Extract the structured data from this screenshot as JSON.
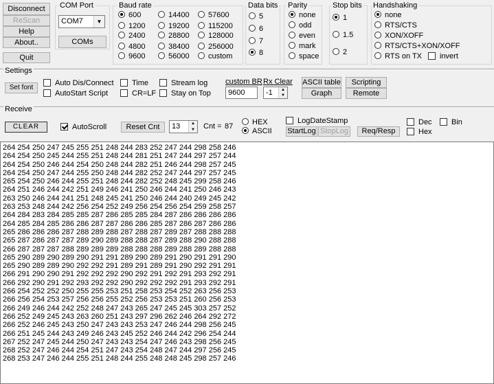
{
  "toolbar": {
    "disconnect": "Disconnect",
    "rescan": "ReScan",
    "help": "Help",
    "about": "About..",
    "quit": "Quit"
  },
  "com_port": {
    "title": "COM Port",
    "selected": "COM7",
    "coms_button": "COMs"
  },
  "baud": {
    "title": "Baud rate",
    "options": [
      "600",
      "1200",
      "2400",
      "4800",
      "9600",
      "14400",
      "19200",
      "28800",
      "38400",
      "56000",
      "57600",
      "115200",
      "128000",
      "256000",
      "custom"
    ],
    "selected": "600"
  },
  "databits": {
    "title": "Data bits",
    "options": [
      "5",
      "6",
      "7",
      "8"
    ],
    "selected": "8"
  },
  "parity": {
    "title": "Parity",
    "options": [
      "none",
      "odd",
      "even",
      "mark",
      "space"
    ],
    "selected": "none"
  },
  "stopbits": {
    "title": "Stop bits",
    "options": [
      "1",
      "1.5",
      "2"
    ],
    "selected": "1"
  },
  "handshaking": {
    "title": "Handshaking",
    "options": [
      "none",
      "RTS/CTS",
      "XON/XOFF",
      "RTS/CTS+XON/XOFF",
      "RTS on TX"
    ],
    "selected": "none",
    "invert_label": "invert"
  },
  "settings": {
    "title": "Settings",
    "set_font": "Set font",
    "auto_dis_connect": "Auto Dis/Connect",
    "autostart_script": "AutoStart Script",
    "time": "Time",
    "cr_lf": "CR=LF",
    "stream_log": "Stream log",
    "stay_on_top": "Stay on Top",
    "custom_br_label": "custom BR",
    "custom_br_value": "9600",
    "rx_clear_label": "Rx Clear",
    "rx_clear_value": "-1",
    "ascii_table": "ASCII table",
    "graph": "Graph",
    "scripting": "Scripting",
    "remote": "Remote"
  },
  "receive": {
    "title": "Receive",
    "clear": "CLEAR",
    "autoscroll": "AutoScroll",
    "reset_cnt": "Reset Cnt",
    "cnt_spin_value": "13",
    "cnt_label": "Cnt =",
    "cnt_value": "87",
    "hex": "HEX",
    "ascii": "ASCII",
    "log_date_stamp": "LogDateStamp",
    "start_log": "StartLog",
    "stop_log": "StopLog",
    "req_resp": "Req/Resp",
    "dec": "Dec",
    "hex_chk": "Hex",
    "bin": "Bin",
    "lines": [
      "264 254 250 247 245 255 251 248 244 283 252 247 244 298 258 246",
      "264 254 250 245 244 255 251 248 244 281 251 247 244 297 257 244",
      "264 254 250 246 244 254 250 248 244 282 251 246 244 298 257 245",
      "264 254 250 247 244 255 250 248 244 282 252 247 244 297 257 245",
      "265 254 250 246 244 255 251 248 244 282 252 248 245 299 258 246",
      "264 251 246 244 242 251 249 246 241 250 246 244 241 250 246 243",
      "263 250 246 244 241 251 248 245 241 250 246 244 240 249 245 242",
      "263 253 248 244 242 256 254 252 249 256 254 256 254 259 258 257",
      "264 284 283 284 285 285 287 286 285 285 284 287 286 286 286 286",
      "264 285 284 285 286 286 287 287 286 286 285 287 286 287 286 286",
      "265 286 286 286 287 288 289 288 287 288 287 289 287 288 288 288",
      "265 287 286 287 287 289 290 289 288 288 287 289 288 290 288 288",
      "266 287 287 287 288 289 289 289 288 288 288 289 288 289 288 288",
      "265 290 289 290 289 290 291 291 289 290 289 291 290 291 291 290",
      "265 290 289 289 290 292 292 291 289 291 289 291 290 292 291 291",
      "266 291 290 290 291 292 292 292 290 292 291 292 291 293 292 291",
      "266 292 290 291 292 293 292 292 290 292 292 292 291 293 292 291",
      "266 254 252 252 250 255 255 253 251 258 253 254 252 263 256 253",
      "266 256 254 253 257 256 256 255 252 256 253 253 251 260 256 253",
      "266 249 246 244 242 252 248 247 243 265 247 245 245 303 257 252",
      "266 252 249 245 243 263 260 251 243 297 296 262 246 264 292 272",
      "266 252 246 245 243 250 247 243 243 253 247 246 244 298 256 245",
      "266 251 245 244 243 249 246 243 245 252 246 244 242 296 254 244",
      "267 252 247 245 244 250 247 243 243 254 247 246 243 298 256 245",
      "268 252 247 246 244 254 251 247 243 254 248 247 244 297 256 245",
      "268 253 247 246 244 255 251 248 244 255 248 248 245 298 257 246"
    ]
  }
}
